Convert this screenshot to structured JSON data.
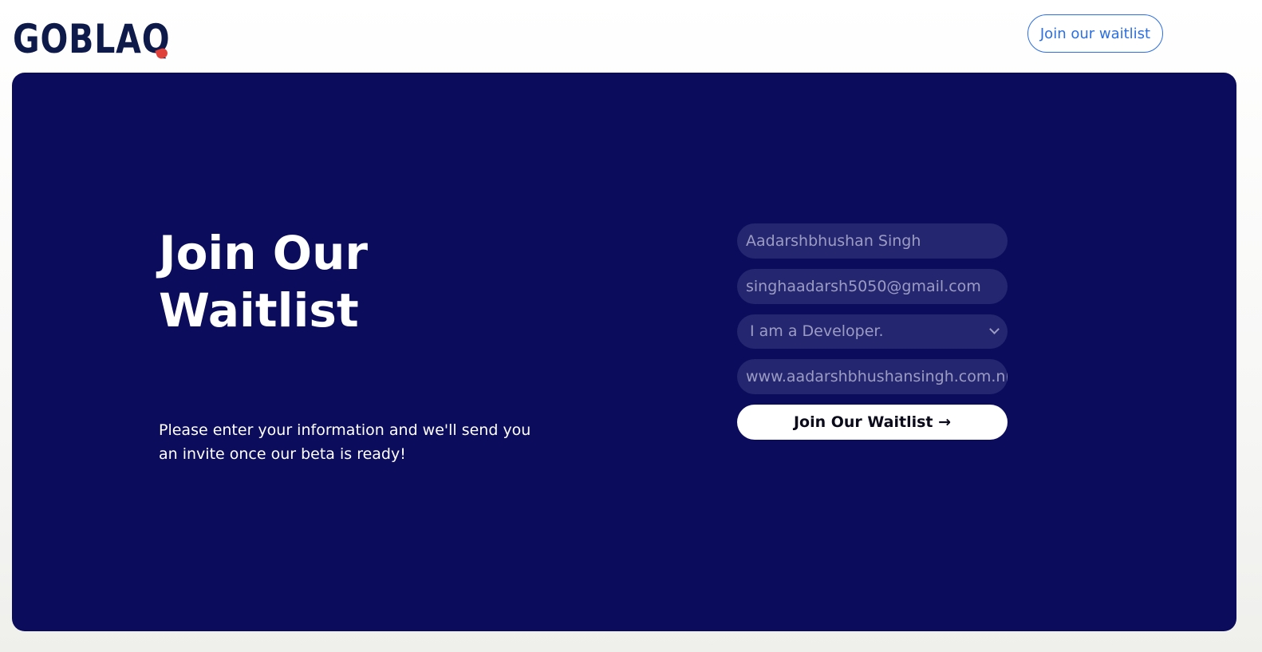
{
  "header": {
    "logo_text": "GOBLAQ",
    "cta_label": "Join our waitlist"
  },
  "hero": {
    "title": "Join Our Waitlist",
    "description": "Please enter your information and we'll send you an invite once our beta is ready!"
  },
  "form": {
    "name_value": "Aadarshbhushan Singh",
    "email_value": "singhaadarsh5050@gmail.com",
    "role_selected": "I am a Developer.",
    "website_value": "www.aadarshbhushansingh.com.np",
    "submit_label": "Join Our Waitlist →"
  },
  "colors": {
    "panel": "#0b0c5c",
    "input_bg": "#252670",
    "accent": "#2b6fe0",
    "logo": "#0e1a4a",
    "logo_mark": "#e0403a"
  }
}
